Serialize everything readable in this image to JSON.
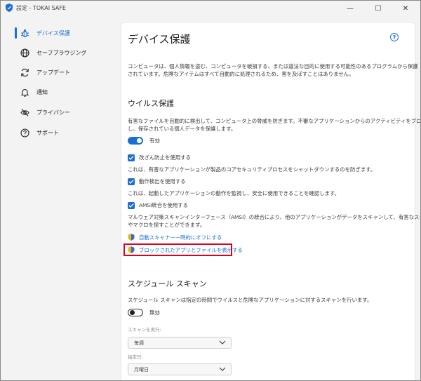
{
  "window": {
    "title": "設定 - TOKAI SAFE",
    "controls": {
      "minimize": "—",
      "maximize": "☐",
      "close": "✕"
    }
  },
  "sidebar": {
    "items": [
      {
        "label": "デバイス保護",
        "icon": "bug-shield-icon",
        "active": true
      },
      {
        "label": "セーフブラウジング",
        "icon": "globe-icon",
        "active": false
      },
      {
        "label": "アップデート",
        "icon": "refresh-icon",
        "active": false
      },
      {
        "label": "通知",
        "icon": "bell-icon",
        "active": false
      },
      {
        "label": "プライバシー",
        "icon": "eye-off-icon",
        "active": false
      },
      {
        "label": "サポート",
        "icon": "help-circle-icon",
        "active": false
      }
    ]
  },
  "main": {
    "title": "デバイス保護",
    "help_icon_label": "?",
    "intro_line1": "コンピュータは、個人情報を盗む、コンピュータを破損する、または違法な目的に使用する可能性のあるプログラムから保護",
    "intro_line2": "されています。危険なアイテムはすべて自動的に処理されるため、害を及ぼすことはありません。",
    "virus": {
      "heading": "ウイルス保護",
      "desc_line1": "有害なファイルを自動的に検出して、コンピュータ上の脅威を防ぎます。不審なアプリケーションからのアクティビティをブロック",
      "desc_line2": "し、保存されている個人データを保護します。",
      "toggle_label": "有効",
      "toggle_on": true,
      "options": [
        {
          "label": "改ざん防止を使用する",
          "checked": true,
          "desc": [
            "これは、有害なアプリケーションが製品のコアセキュリティプロセスをシャットダウンするのを防ぎます。"
          ]
        },
        {
          "label": "動作検出を使用する",
          "checked": true,
          "desc": [
            "これは、起動したアプリケーションの動作を監視し、安全に使用できることを確認します。"
          ]
        },
        {
          "label": "AMSI統合を使用する",
          "checked": true,
          "desc": [
            "マルウェア対策スキャンインターフェース（AMSI）の統合により、他のアプリケーションがデータをスキャンして、有害なスクリプト",
            "やマクロを探すことができます。"
          ]
        }
      ],
      "link_disable": "自動スキャナー一時的にオフにする",
      "link_blocked": "ブロックされたアプリとファイルを表示する"
    },
    "schedule": {
      "heading": "スケジュール スキャン",
      "desc": "スケジュール スキャンは指定の時間でウイルスと危険なアプリケーションに対するスキャンを行います。",
      "toggle_label": "無効",
      "toggle_on": false,
      "run_label": "スキャンを実行:",
      "run_value": "毎週",
      "day_label": "指定日:",
      "day_value": "月曜日"
    }
  },
  "colors": {
    "accent": "#1a6fd1",
    "highlight": "#e0001b"
  }
}
